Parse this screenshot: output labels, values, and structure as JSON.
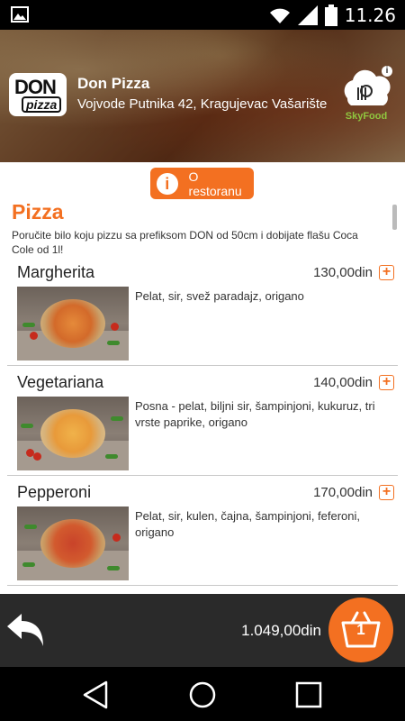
{
  "status_bar": {
    "time": "11.26"
  },
  "header": {
    "restaurant_name": "Don Pizza",
    "address": "Vojvode Putnika 42, Kragujevac Vašarište",
    "logo_top": "DON",
    "logo_bottom": "pizza",
    "partner_logo": "SkyFood",
    "info_icon": "i"
  },
  "about_button": {
    "icon": "i",
    "label": "O restoranu"
  },
  "section": {
    "title": "Pizza",
    "description": "Poručite bilo koju pizzu sa prefiksom DON od 50cm i dobijate flašu Coca Cole od 1l!"
  },
  "items": [
    {
      "name": "Margherita",
      "price": "130,00din",
      "description": "Pelat, sir, svež paradajz, origano",
      "add_icon": "+"
    },
    {
      "name": "Vegetariana",
      "price": "140,00din",
      "description": "Posna - pelat, biljni sir, šampinjoni, kukuruz, tri vrste paprike, origano",
      "add_icon": "+"
    },
    {
      "name": "Pepperoni",
      "price": "170,00din",
      "description": "Pelat, sir, kulen, čajna, šampinjoni, feferoni, origano",
      "add_icon": "+"
    }
  ],
  "footer": {
    "total": "1.049,00din",
    "cart_count": "1"
  },
  "colors": {
    "accent": "#f37021",
    "bottom_bar": "#2a2a2a"
  }
}
